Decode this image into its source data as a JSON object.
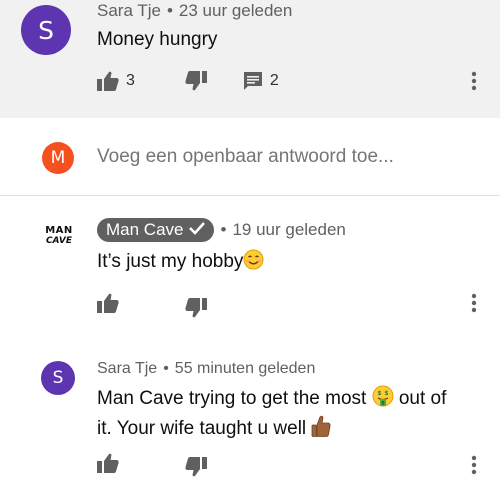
{
  "comments": [
    {
      "author": "Sara Tje",
      "avatar_letter": "S",
      "avatar_color": "#5e35b1",
      "time": "23 uur geleden",
      "text": "Money hungry",
      "likes": "3",
      "replies": "2"
    },
    {
      "author": "Man Cave",
      "logo_line1": "MAN",
      "logo_line2": "CAVE",
      "time": "19 uur geleden",
      "text": "It’s just my hobby"
    },
    {
      "author": "Sara Tje",
      "avatar_letter": "S",
      "avatar_color": "#5e35b1",
      "time": "55 minuten geleden",
      "text_line1_a": "Man Cave trying to get the most",
      "text_line1_b": "out of",
      "text_line2": "it. Your wife taught u well"
    }
  ],
  "reply_box": {
    "avatar_letter": "M",
    "avatar_color": "#f4511e",
    "placeholder": "Voeg een openbaar antwoord toe..."
  },
  "separator": "•",
  "icons": {
    "like": "thumb-up-icon",
    "dislike": "thumb-down-icon",
    "reply": "comment-icon",
    "more": "more-vert-icon",
    "verified": "check-icon",
    "emoji_smile": "smiling-face-emoji",
    "emoji_money": "money-mouth-face-emoji",
    "emoji_thumb": "thumbs-up-emoji"
  }
}
